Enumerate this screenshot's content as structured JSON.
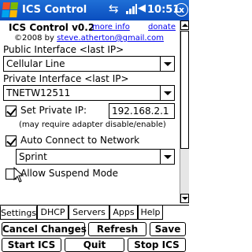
{
  "status_bar": {
    "app_title": "ICS Control",
    "clock": "10:51",
    "close_label": "x",
    "icons": [
      "windows-start-icon",
      "connection-icon",
      "signal-icon",
      "volume-icon"
    ]
  },
  "header": {
    "app_name": "ICS Control v0.2",
    "more_info": "more info",
    "donate": "donate",
    "copyright_prefix": "©2008 by ",
    "email": "steve.atherton@gmail.com"
  },
  "form": {
    "public_label": "Public Interface <last IP>",
    "public_value": "Cellular Line",
    "private_label": "Private Interface <last IP>",
    "private_value": "TNETW12511",
    "set_private_ip_label": "Set Private IP:",
    "set_private_ip_checked": true,
    "private_ip_value": "192.168.2.1",
    "note": "(may require adapter disable/enable)",
    "auto_connect_label": "Auto Connect to Network",
    "auto_connect_checked": true,
    "network_value": "Sprint",
    "allow_suspend_label": "Allow Suspend Mode",
    "allow_suspend_checked": false
  },
  "tabs": [
    {
      "label": "Settings",
      "active": true
    },
    {
      "label": "DHCP",
      "active": false
    },
    {
      "label": "Servers",
      "active": false
    },
    {
      "label": "Apps",
      "active": false
    },
    {
      "label": "Help",
      "active": false
    }
  ],
  "buttons": {
    "cancel_changes": "Cancel Changes",
    "refresh": "Refresh",
    "save": "Save",
    "start_ics": "Start ICS",
    "quit": "Quit",
    "stop_ics": "Stop ICS"
  }
}
